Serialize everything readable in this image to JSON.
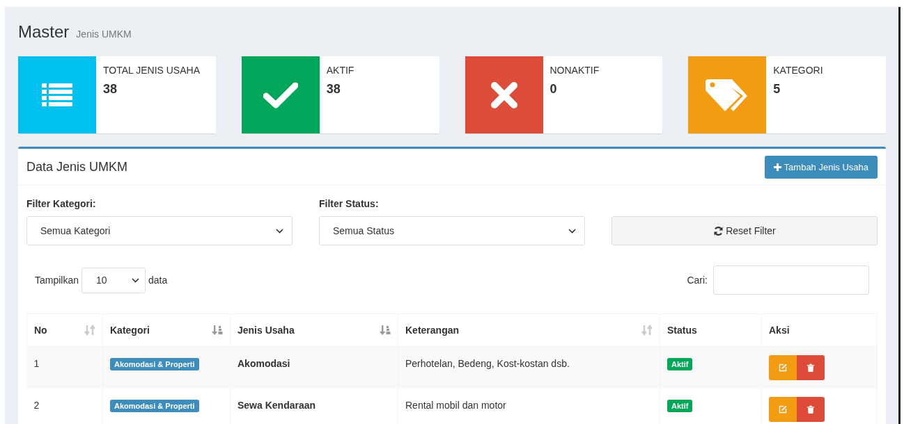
{
  "header": {
    "title": "Master",
    "subtitle": "Jenis UMKM"
  },
  "stats": [
    {
      "label": "TOTAL JENIS USAHA",
      "value": "38",
      "color": "#00c0ef",
      "kind": "list"
    },
    {
      "label": "AKTIF",
      "value": "38",
      "color": "#00a65a",
      "kind": "check"
    },
    {
      "label": "NONAKTIF",
      "value": "0",
      "color": "#dd4b39",
      "kind": "cross"
    },
    {
      "label": "KATEGORI",
      "value": "5",
      "color": "#f39c12",
      "kind": "tags"
    }
  ],
  "card": {
    "title": "Data Jenis UMKM",
    "add_button": "Tambah Jenis Usaha",
    "filters": [
      {
        "label": "Filter Kategori:",
        "value": "Semua Kategori"
      },
      {
        "label": "Filter Status:",
        "value": "Semua Status"
      }
    ],
    "reset_button": "Reset Filter",
    "length": {
      "before": "Tampilkan",
      "value": "10",
      "after": "data"
    },
    "search": {
      "label": "Cari:"
    },
    "table": {
      "columns": [
        {
          "label": "No",
          "kind": "sortable"
        },
        {
          "label": "Kategori",
          "kind": "sorted"
        },
        {
          "label": "Jenis Usaha",
          "kind": "sorted"
        },
        {
          "label": "Keterangan",
          "kind": "sortable"
        },
        {
          "label": "Status",
          "kind": "plain"
        },
        {
          "label": "Aksi",
          "kind": "plain"
        }
      ],
      "rows": [
        {
          "no": "1",
          "category": "Akomodasi & Properti",
          "name": "Akomodasi",
          "description": "Perhotelan, Bedeng, Kost-kostan dsb.",
          "status": "Aktif",
          "active": true
        },
        {
          "no": "2",
          "category": "Akomodasi & Properti",
          "name": "Sewa Kendaraan",
          "description": "Rental mobil dan motor",
          "status": "Aktif",
          "active": true
        }
      ]
    }
  }
}
